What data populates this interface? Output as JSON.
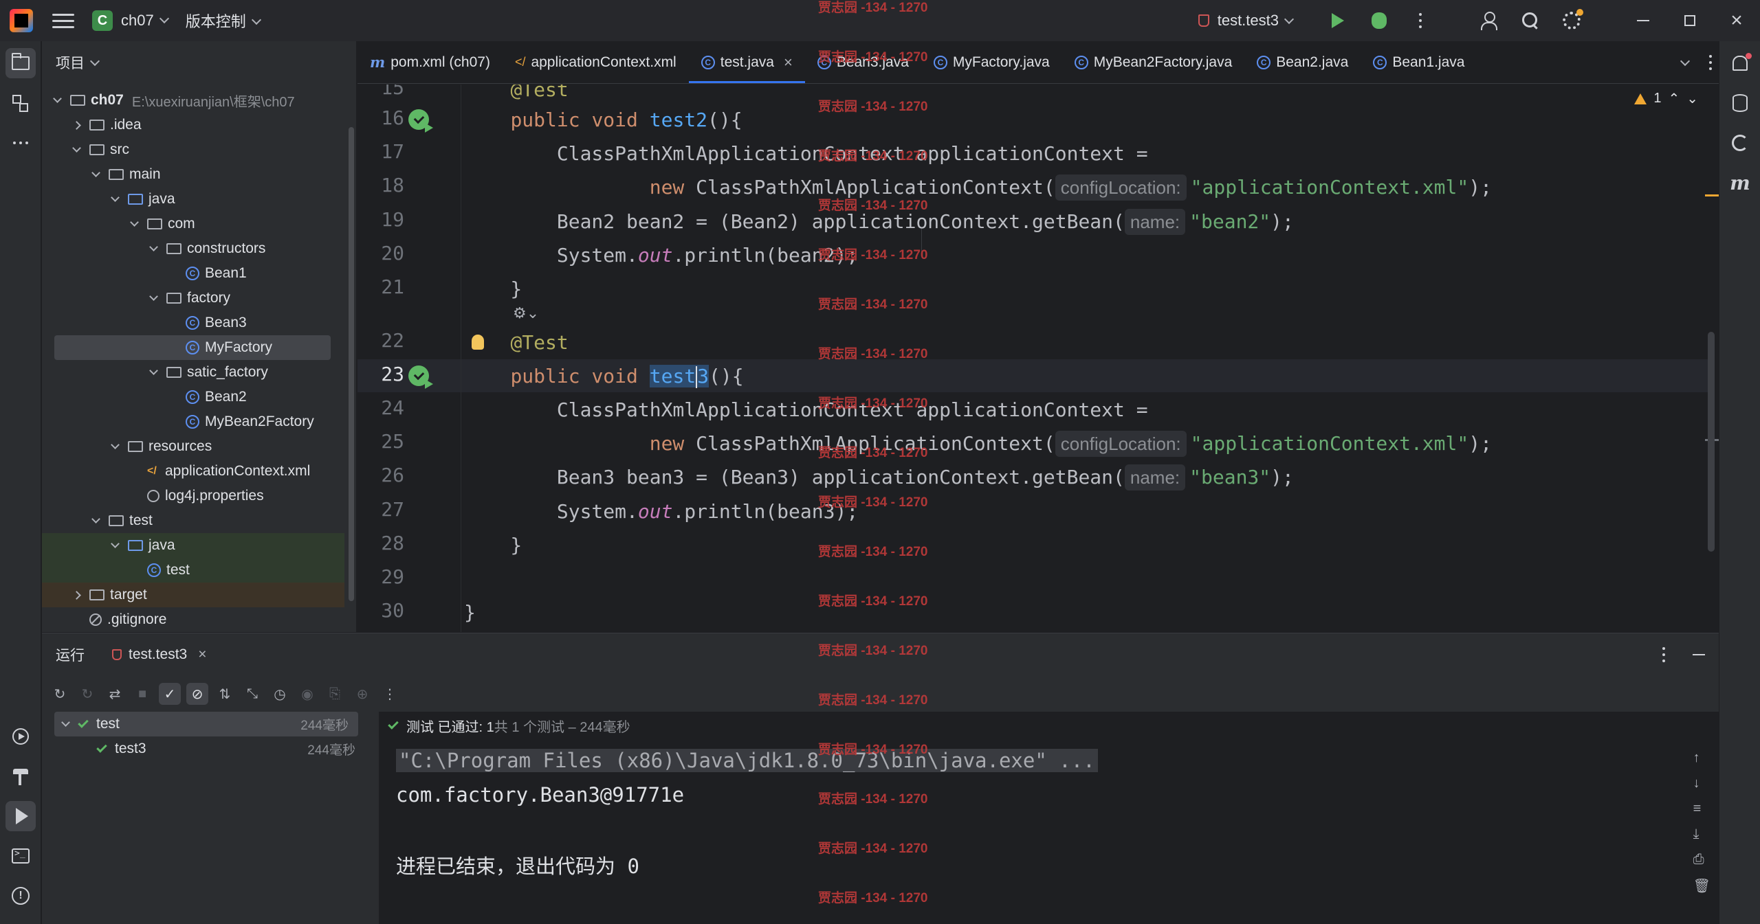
{
  "titlebar": {
    "project_badge": "C",
    "project_name": "ch07",
    "vcs_label": "版本控制",
    "run_config": "test.test3"
  },
  "project_panel": {
    "title": "项目",
    "tree": [
      {
        "label": "ch07",
        "extra": "E:\\xuexiruanjian\\框架\\ch07",
        "depth": 0,
        "kind": "module",
        "expanded": true
      },
      {
        "label": ".idea",
        "depth": 1,
        "kind": "folder",
        "expanded": false
      },
      {
        "label": "src",
        "depth": 1,
        "kind": "folder",
        "expanded": true
      },
      {
        "label": "main",
        "depth": 2,
        "kind": "folder",
        "expanded": true
      },
      {
        "label": "java",
        "depth": 3,
        "kind": "src-folder",
        "expanded": true
      },
      {
        "label": "com",
        "depth": 4,
        "kind": "package",
        "expanded": true
      },
      {
        "label": "constructors",
        "depth": 5,
        "kind": "package",
        "expanded": true
      },
      {
        "label": "Bean1",
        "depth": 6,
        "kind": "class"
      },
      {
        "label": "factory",
        "depth": 5,
        "kind": "package",
        "expanded": true
      },
      {
        "label": "Bean3",
        "depth": 6,
        "kind": "class"
      },
      {
        "label": "MyFactory",
        "depth": 6,
        "kind": "class",
        "selected": true
      },
      {
        "label": "satic_factory",
        "depth": 5,
        "kind": "package",
        "expanded": true
      },
      {
        "label": "Bean2",
        "depth": 6,
        "kind": "class"
      },
      {
        "label": "MyBean2Factory",
        "depth": 6,
        "kind": "class"
      },
      {
        "label": "resources",
        "depth": 3,
        "kind": "res-folder",
        "expanded": true
      },
      {
        "label": "applicationContext.xml",
        "depth": 4,
        "kind": "xml"
      },
      {
        "label": "log4j.properties",
        "depth": 4,
        "kind": "props"
      },
      {
        "label": "test",
        "depth": 2,
        "kind": "folder",
        "expanded": true
      },
      {
        "label": "java",
        "depth": 3,
        "kind": "test-folder",
        "expanded": true,
        "green": true
      },
      {
        "label": "test",
        "depth": 4,
        "kind": "class-test",
        "green": true
      },
      {
        "label": "target",
        "depth": 1,
        "kind": "folder-excluded",
        "expanded": false,
        "brown": true
      },
      {
        "label": ".gitignore",
        "depth": 1,
        "kind": "ignore"
      }
    ]
  },
  "tabs": [
    {
      "label": "pom.xml (ch07)",
      "icon": "m"
    },
    {
      "label": "applicationContext.xml",
      "icon": "xml"
    },
    {
      "label": "test.java",
      "icon": "class",
      "active": true
    },
    {
      "label": "Bean3.java",
      "icon": "class"
    },
    {
      "label": "MyFactory.java",
      "icon": "class"
    },
    {
      "label": "MyBean2Factory.java",
      "icon": "class"
    },
    {
      "label": "Bean2.java",
      "icon": "class"
    },
    {
      "label": "Bean1.java",
      "icon": "class"
    }
  ],
  "editor": {
    "warning_count": "1",
    "line_numbers": [
      "15",
      "16",
      "17",
      "18",
      "19",
      "20",
      "21",
      "22",
      "23",
      "24",
      "25",
      "26",
      "27",
      "28",
      "29",
      "30"
    ],
    "hint_config": "configLocation:",
    "hint_name": "name:",
    "watermark": "贾志园 -134 - 1270"
  },
  "run_panel": {
    "title": "运行",
    "tab_label": "test.test3",
    "tree": [
      {
        "label": "test",
        "time": "244毫秒"
      },
      {
        "label": "test3",
        "time": "244毫秒"
      }
    ],
    "status_passed": "测试 已通过: 1",
    "status_detail": "共 1 个测试 – 244毫秒",
    "console": [
      "\"C:\\Program Files (x86)\\Java\\jdk1.8.0_73\\bin\\java.exe\" ...",
      "com.factory.Bean3@91771e",
      "",
      "进程已结束，退出代码为 0"
    ]
  },
  "colors": {
    "accent": "#3574f0",
    "pass": "#5fb865",
    "keyword": "#cf8e6d",
    "string": "#6aab73",
    "function": "#56a8f5"
  }
}
